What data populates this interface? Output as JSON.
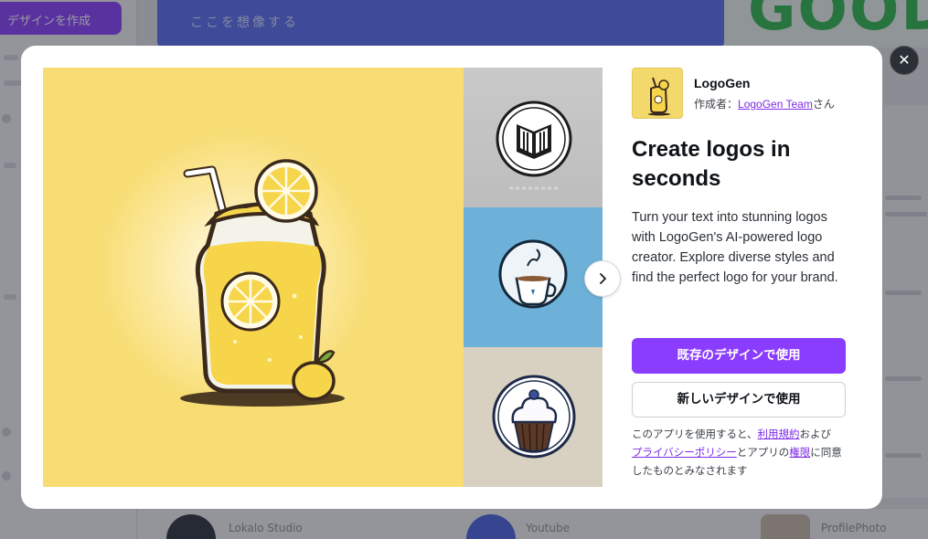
{
  "background": {
    "sidebar_button_label": "デザインを作成",
    "banner_text": "ここを想像する",
    "green_word": "GOOD",
    "bottom_items": [
      "Lokalo Studio",
      "Youtube",
      "ProfilePhoto"
    ]
  },
  "modal": {
    "close_label": "✕",
    "app": {
      "name": "LogoGen",
      "author_prefix": "作成者：",
      "author_name": "LogoGen Team",
      "author_suffix": "さん"
    },
    "headline": "Create logos in seconds",
    "description": "Turn your text into stunning logos with LogoGen's AI-powered logo creator. Explore diverse styles and find the perfect logo for your brand.",
    "buttons": {
      "use_existing": "既存のデザインで使用",
      "use_new": "新しいデザインで使用"
    },
    "terms": {
      "part1": "このアプリを使用すると、",
      "link_terms": "利用規約",
      "part2": "および",
      "link_privacy": "プライバシーポリシー",
      "part3": "とアプリの",
      "link_permissions": "権限",
      "part4": "に同意したものとみなされます"
    },
    "gallery": {
      "hero": "lemonade-illustration",
      "thumbnails": [
        "book-logo",
        "coffee-cup-logo",
        "cupcake-logo"
      ],
      "next_icon": "chevron-right-icon"
    }
  },
  "colors": {
    "accent": "#8b3dff",
    "link": "#7d2ae8",
    "hero_background": "#f8dd75"
  }
}
